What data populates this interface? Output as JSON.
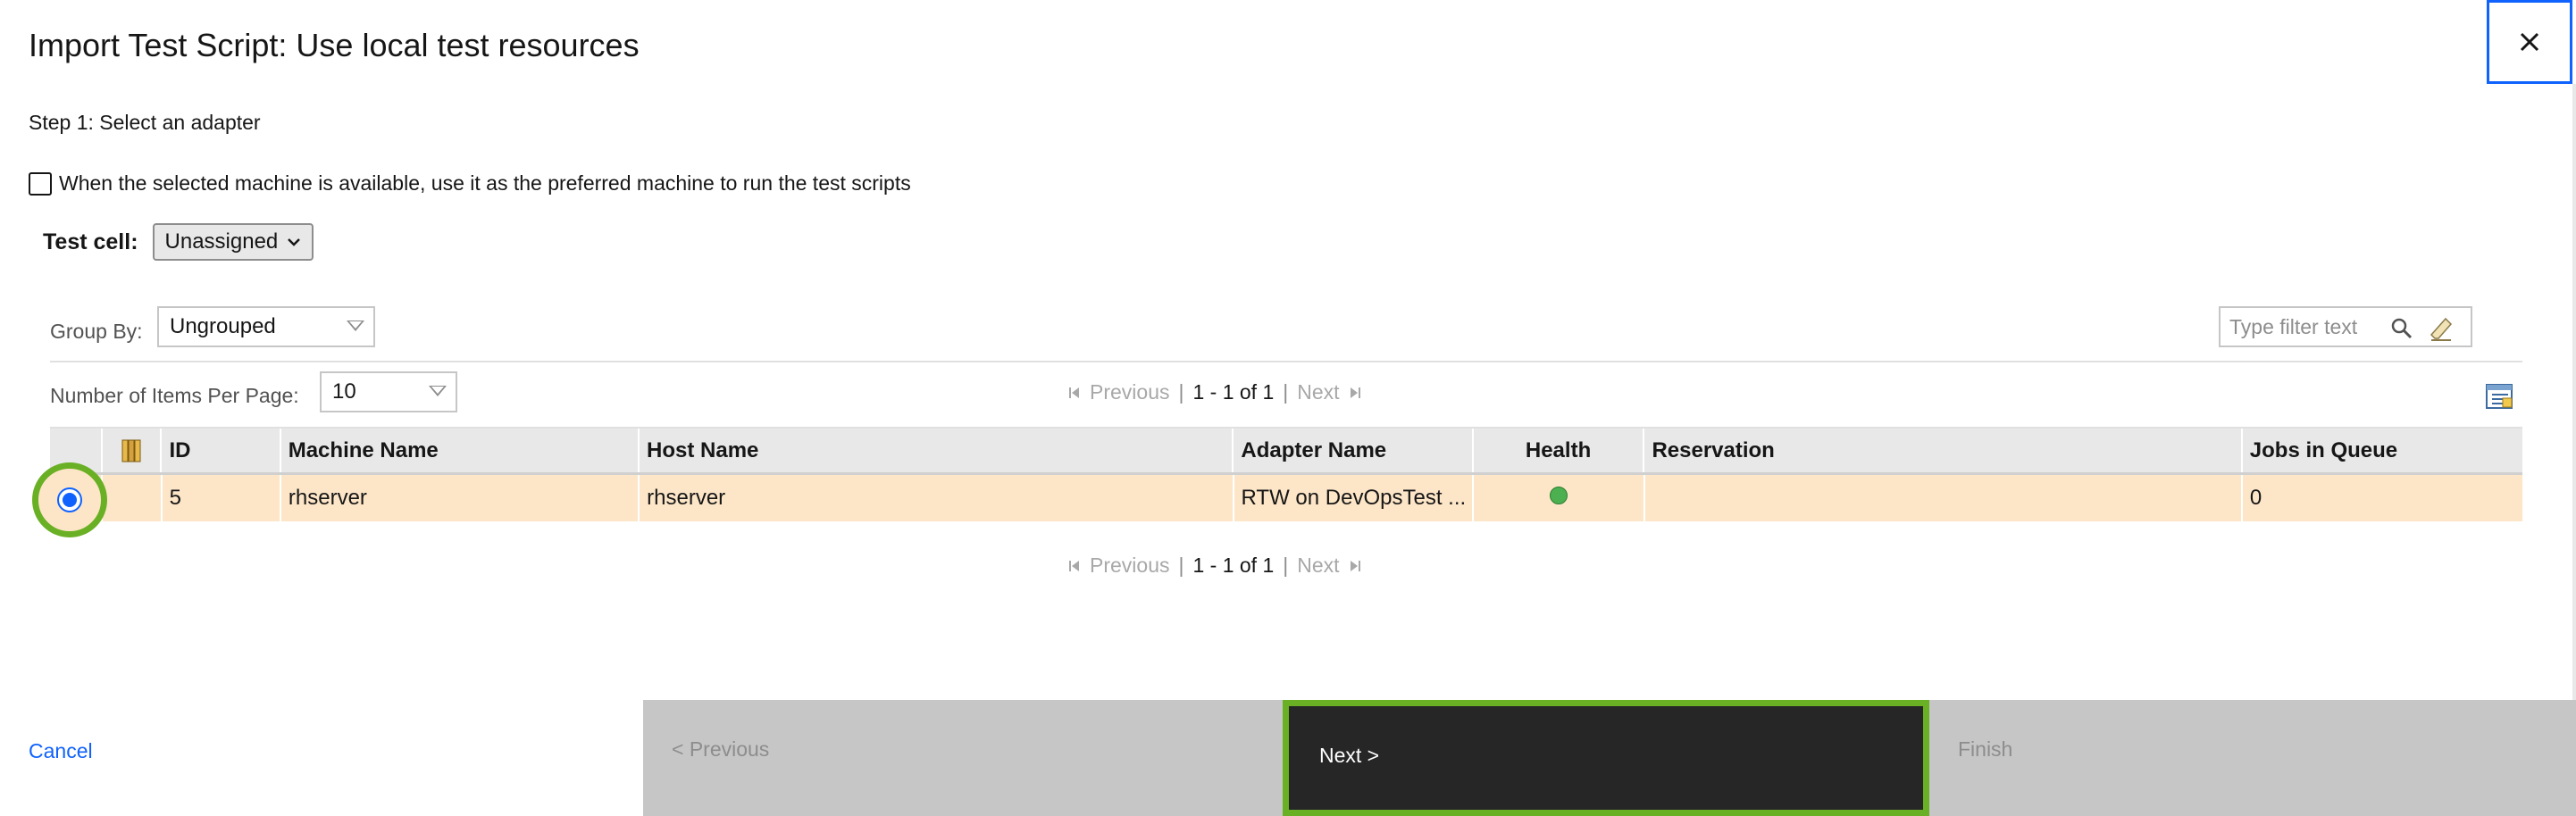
{
  "dialog": {
    "title": "Import Test Script: Use local test resources",
    "step": "Step 1: Select an adapter",
    "preferred_machine_label": "When the selected machine is available, use it as the preferred machine to run the test scripts",
    "preferred_machine_checked": false
  },
  "test_cell": {
    "label": "Test cell:",
    "value": "Unassigned"
  },
  "group_by": {
    "label": "Group By:",
    "value": "Ungrouped"
  },
  "filter": {
    "placeholder": "Type filter text"
  },
  "per_page": {
    "label": "Number of Items Per Page:",
    "value": "10"
  },
  "pager": {
    "previous": "Previous",
    "info": "1 - 1 of 1",
    "next": "Next",
    "separator": "|"
  },
  "table": {
    "columns": [
      "ID",
      "Machine Name",
      "Host Name",
      "Adapter Name",
      "Health",
      "Reservation",
      "Jobs in Queue"
    ],
    "rows": [
      {
        "id": "5",
        "machine_name": "rhserver",
        "host_name": "rhserver",
        "adapter_name": "RTW on DevOpsTest ...",
        "health": "healthy",
        "reservation": "",
        "jobs_in_queue": "0",
        "selected": true
      }
    ]
  },
  "footer": {
    "cancel": "Cancel",
    "previous": "< Previous",
    "next": "Next >",
    "finish": "Finish"
  },
  "colors": {
    "accent": "#0f62fe",
    "highlight": "#6ab024",
    "selected_row": "#fde6c8",
    "health_ok": "#4caf50"
  }
}
